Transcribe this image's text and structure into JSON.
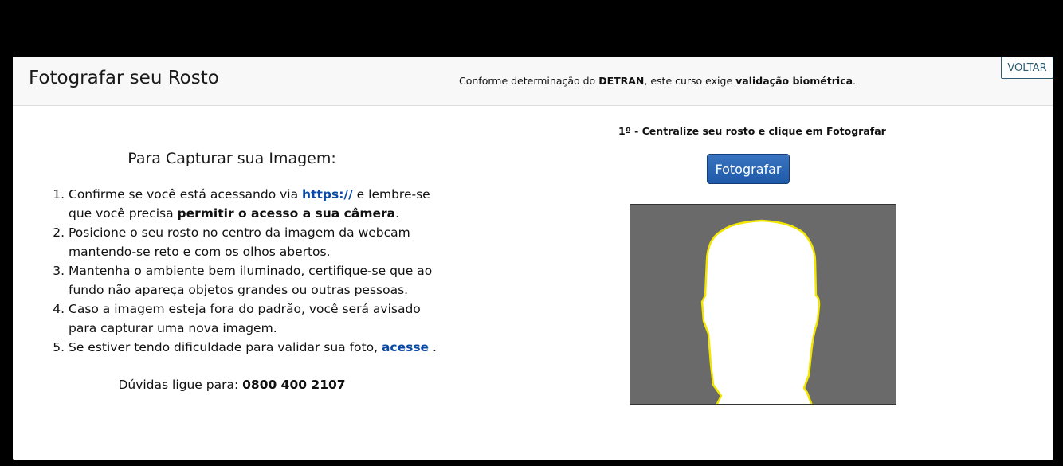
{
  "header": {
    "title": "Fotografar seu Rosto",
    "notice_pre": "Conforme determinação do ",
    "notice_bold1": "DETRAN",
    "notice_mid": ", este curso exige ",
    "notice_bold2": "validação biométrica",
    "notice_end": ".",
    "back_label": "VOLTAR"
  },
  "instructions": {
    "title": "Para Capturar sua Imagem:",
    "step1_pre": "Confirme se você está acessando via ",
    "step1_link": "https://",
    "step1_mid": " e lembre-se que você precisa ",
    "step1_bold": "permitir o acesso a sua câmera",
    "step1_end": ".",
    "step2": "Posicione o seu rosto no centro da imagem da webcam mantendo-se reto e com os olhos abertos.",
    "step3": "Mantenha o ambiente bem iluminado, certifique-se que ao fundo não apareça objetos grandes ou outras pessoas.",
    "step4": "Caso a imagem esteja fora do padrão, você será avisado para capturar uma nova imagem.",
    "step5_pre": "Se estiver tendo dificuldade para validar sua foto, ",
    "step5_link": "acesse",
    "step5_end": " .",
    "phone_label": "Dúvidas ligue para: ",
    "phone_number": "0800 400 2107"
  },
  "capture": {
    "caption": "1º - Centralize seu rosto e clique em Fotografar",
    "button_label": "Fotografar"
  },
  "colors": {
    "frame_bg": "#6a6a6a",
    "silhouette_fill": "#ffffff",
    "silhouette_outline": "#f2e600",
    "button_blue": "#1e5aa8",
    "link_blue": "#0a4aa6"
  }
}
